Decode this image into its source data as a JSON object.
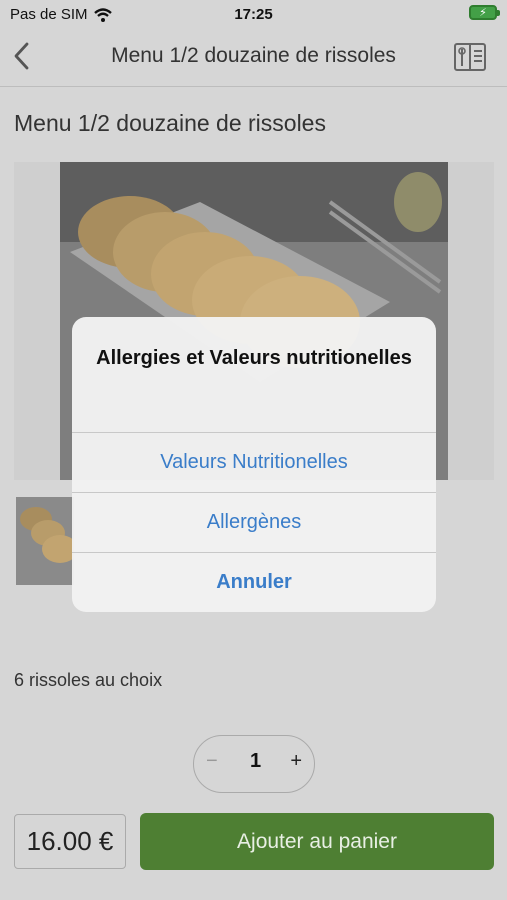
{
  "status": {
    "carrier": "Pas de SIM",
    "time": "17:25"
  },
  "nav": {
    "title": "Menu 1/2 douzaine de rissoles"
  },
  "product": {
    "title": "Menu 1/2 douzaine de rissoles",
    "description": "6 rissoles au choix",
    "quantity": "1",
    "price": "16.00 €",
    "add_label": "Ajouter au panier"
  },
  "alert": {
    "title": "Allergies et Valeurs nutritionelles",
    "buttons": [
      "Valeurs Nutritionelles",
      "Allergènes",
      "Annuler"
    ]
  },
  "colors": {
    "accent": "#4e7f33",
    "link": "#3a7dc9"
  }
}
